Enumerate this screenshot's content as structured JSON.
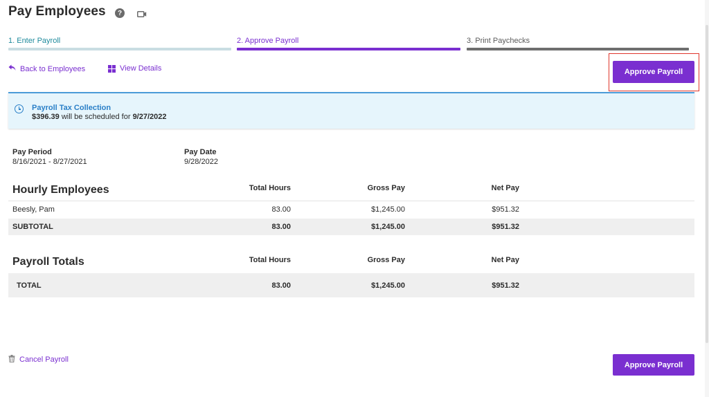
{
  "header": {
    "title": "Pay Employees",
    "help_icon": "help-circle-icon",
    "help_glyph": "?",
    "video_icon": "video-icon"
  },
  "steps": [
    {
      "label": "1. Enter Payroll",
      "state": "done",
      "color": "#c9dde2"
    },
    {
      "label": "2. Approve Payroll",
      "state": "current",
      "color": "#7a2fd0"
    },
    {
      "label": "3. Print Paychecks",
      "state": "pending",
      "color": "#6e6e6e"
    }
  ],
  "actions": {
    "back_label": "Back to Employees",
    "back_icon": "reply-arrow-icon",
    "view_label": "View Details",
    "view_icon": "grid-icon",
    "approve_label": "Approve Payroll",
    "cancel_label": "Cancel Payroll",
    "cancel_icon": "trash-icon"
  },
  "banner": {
    "title": "Payroll Tax Collection",
    "amount": "$396.39",
    "middle_text": "will be scheduled for",
    "date": "9/27/2022",
    "icon": "clock-icon"
  },
  "pay_info": {
    "period_label": "Pay Period",
    "period_value": "8/16/2021 - 8/27/2021",
    "date_label": "Pay Date",
    "date_value": "9/28/2022"
  },
  "hourly": {
    "title": "Hourly Employees",
    "columns": [
      "Total Hours",
      "Gross Pay",
      "Net Pay"
    ],
    "rows": [
      {
        "name": "Beesly, Pam",
        "hours": "83.00",
        "gross": "$1,245.00",
        "net": "$951.32"
      }
    ],
    "subtotal": {
      "label": "SUBTOTAL",
      "hours": "83.00",
      "gross": "$1,245.00",
      "net": "$951.32"
    }
  },
  "totals": {
    "title": "Payroll Totals",
    "columns": [
      "Total Hours",
      "Gross Pay",
      "Net Pay"
    ],
    "total": {
      "label": "TOTAL",
      "hours": "83.00",
      "gross": "$1,245.00",
      "net": "$951.32"
    }
  },
  "colors": {
    "accent": "#7a2fd0",
    "info_blue": "#2a7fc7",
    "highlight_red": "#e0352b"
  }
}
